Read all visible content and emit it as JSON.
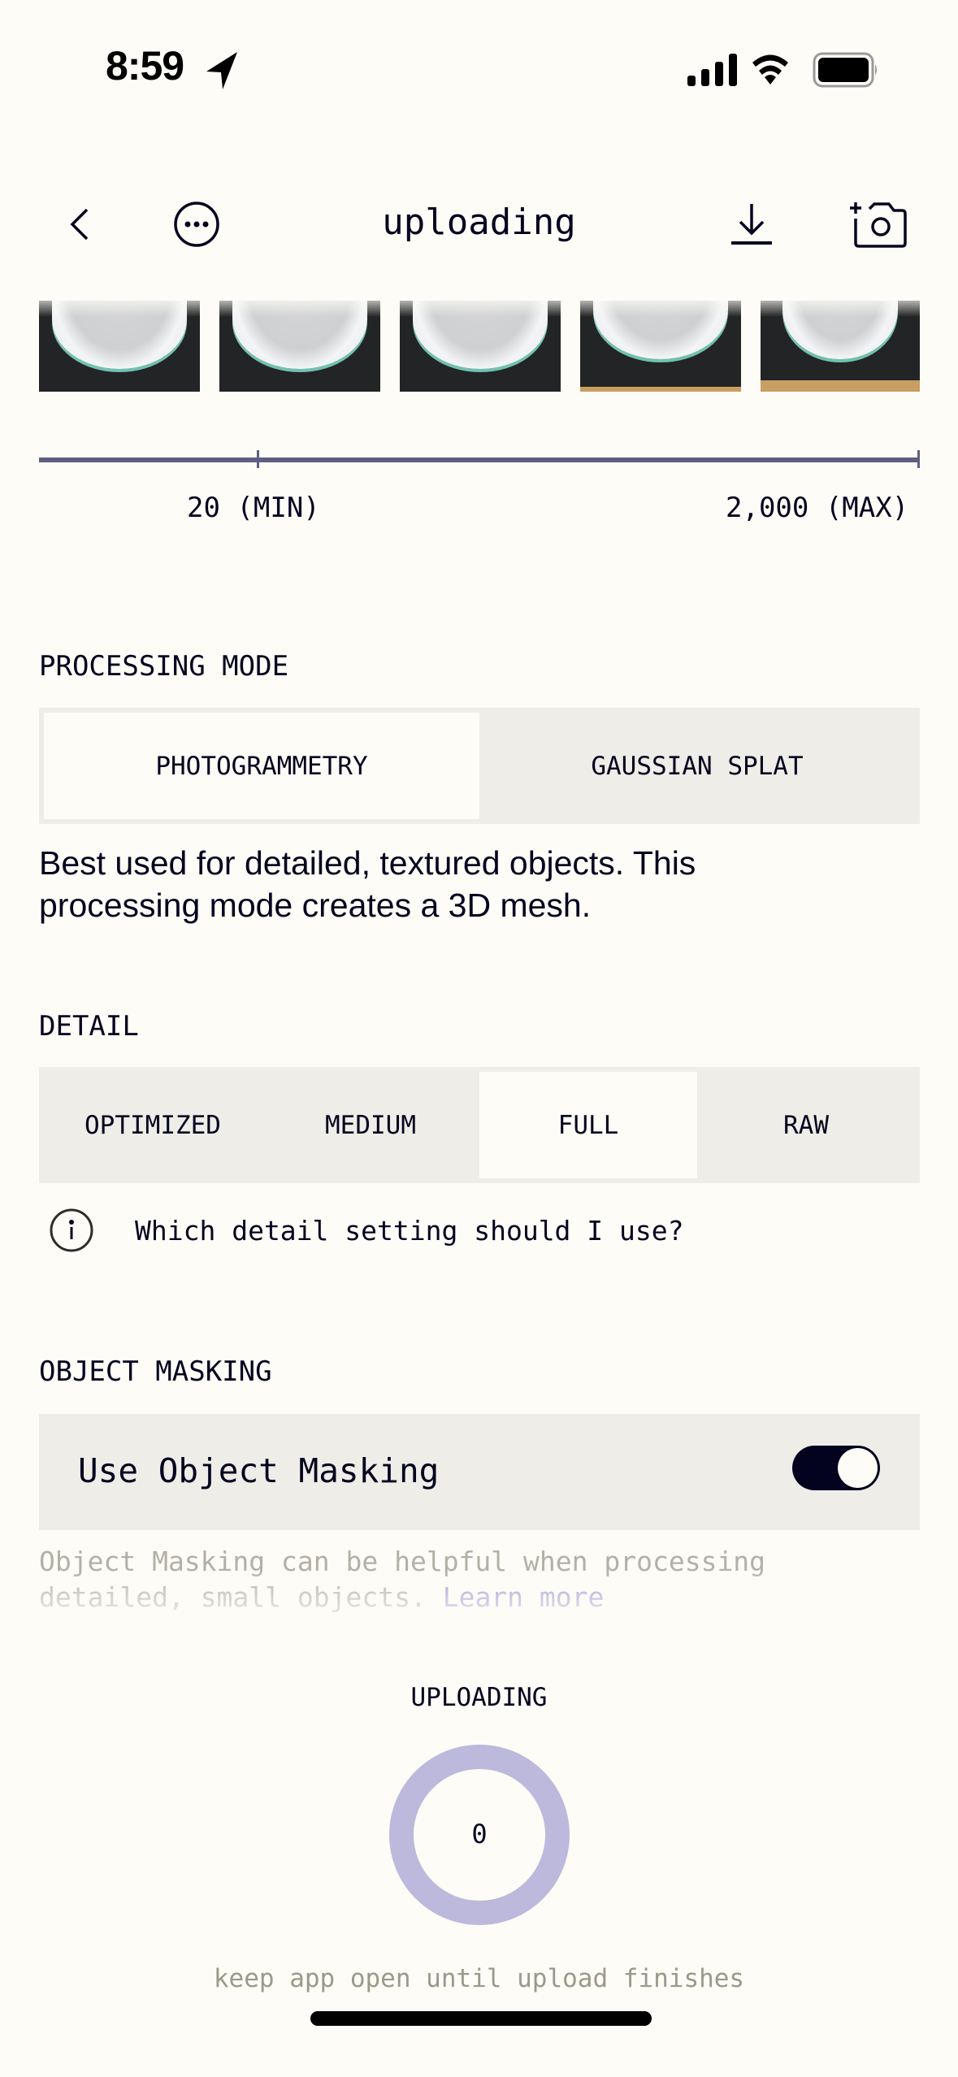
{
  "status_bar": {
    "time": "8:59"
  },
  "header": {
    "title": "uploading"
  },
  "thumbnails": {
    "count": 5
  },
  "slider": {
    "min_label": "20 (MIN)",
    "max_label": "2,000 (MAX)",
    "min": 20,
    "max": 2000,
    "current_value": 2000
  },
  "processing_mode": {
    "label": "PROCESSING MODE",
    "options": [
      "PHOTOGRAMMETRY",
      "GAUSSIAN SPLAT"
    ],
    "selected": "PHOTOGRAMMETRY",
    "description": "Best used for detailed, textured objects. This processing mode creates a 3D mesh."
  },
  "detail": {
    "label": "DETAIL",
    "options": [
      "OPTIMIZED",
      "MEDIUM",
      "FULL",
      "RAW"
    ],
    "selected": "FULL",
    "help_text": "Which detail setting should I use?"
  },
  "object_masking": {
    "label": "OBJECT MASKING",
    "toggle_label": "Use Object Masking",
    "enabled": true,
    "help_text": "Object Masking can be helpful when processing detailed, small objects.",
    "learn_more": "Learn more"
  },
  "upload": {
    "title": "UPLOADING",
    "progress_value": "0",
    "progress_fraction": 0,
    "note": "keep app open until upload finishes"
  },
  "colors": {
    "background": "#fdfcf7",
    "text": "#05041f",
    "segment_bg": "#eeede7",
    "slider": "#5e5f80",
    "ring": "#bdb9dc",
    "link": "#a09ed2",
    "muted": "#b3b1a5"
  }
}
